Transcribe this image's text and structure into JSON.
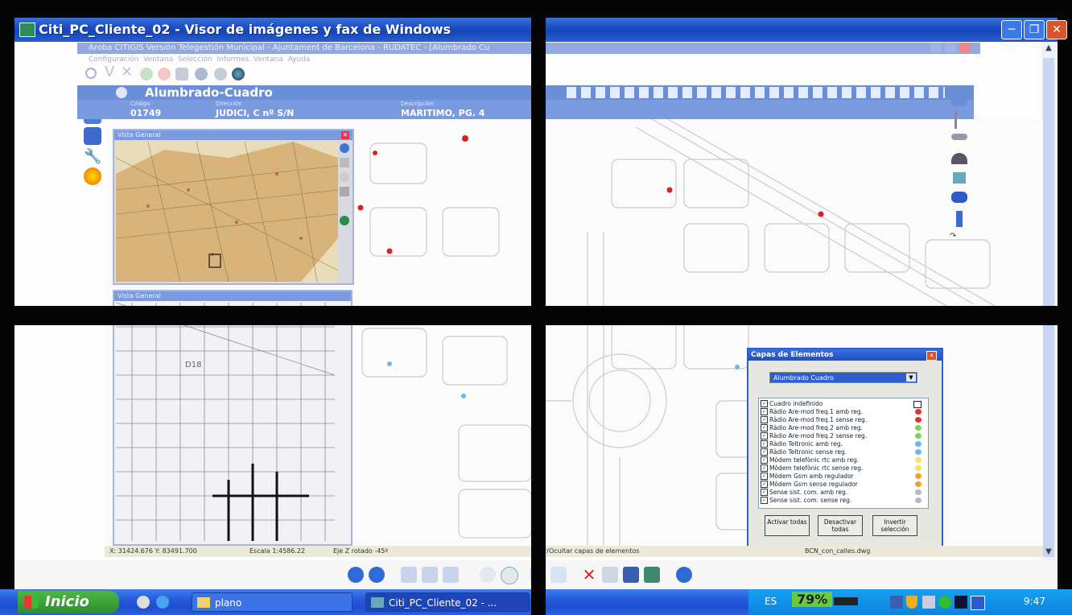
{
  "window": {
    "title": "Citi_PC_Cliente_02 - Visor de imágenes y fax de Windows",
    "controls": [
      "minimize",
      "maximize",
      "close"
    ]
  },
  "app": {
    "title": "Aroba CITIGIS Versión Telegestión Municipal - Ajuntament de Barcelona - RUDATEC - [Alumbrado Cu",
    "menu": [
      "Configuración",
      "Ventana",
      "Selección",
      "Informes",
      "Ventana",
      "Ayuda"
    ],
    "record_header": "Alumbrado-Cuadro",
    "fields": [
      {
        "label": "Código",
        "value": "01749"
      },
      {
        "label": "Dirección",
        "value": "JUDICI, C nº S/N"
      },
      {
        "label": "Descripción",
        "value": "MARITIMO, PG. 4"
      }
    ]
  },
  "overview": {
    "title_1": "Vista General",
    "title_2": "Vista General",
    "map_label": "D18"
  },
  "layers_panel": {
    "title": "Capas de Elementos",
    "selected": "Alumbrado Cuadro",
    "items": [
      {
        "label": "Cuadro indefinido",
        "color": "#ffffff"
      },
      {
        "label": "Ràdio Are-mod freq.1 amb reg.",
        "color": "#e8302a"
      },
      {
        "label": "Ràdio Are-mod freq.1 sense reg.",
        "color": "#e8302a"
      },
      {
        "label": "Ràdio Are-mod freq.2 amb reg.",
        "color": "#7bd35a"
      },
      {
        "label": "Ràdio Are-mod freq.2 sense reg.",
        "color": "#7bd35a"
      },
      {
        "label": "Ràdio Teltronic amb reg.",
        "color": "#6fb6ea"
      },
      {
        "label": "Ràdio Teltronic sense reg.",
        "color": "#6fb6ea"
      },
      {
        "label": "Mòdem telefònic rtc amb reg.",
        "color": "#f2e46a"
      },
      {
        "label": "Mòdem telefònic rtc sense reg.",
        "color": "#f2e46a"
      },
      {
        "label": "Mòdem Gsm amb regulador",
        "color": "#f0a030"
      },
      {
        "label": "Mòdem Gsm sense regulador",
        "color": "#f0a030"
      },
      {
        "label": "Sense sist. com. amb reg.",
        "color": "#b8b8c0"
      },
      {
        "label": "Sense sist. com. sense reg.",
        "color": "#b8b8c0"
      }
    ],
    "buttons": [
      "Activar todas",
      "Desactivar todas",
      "Invertir selección"
    ]
  },
  "status_bar": {
    "coords": "X: 31424.676  Y: 83491.700",
    "scale": "Escala 1:4586.22",
    "rotation": "Eje Z rotado -45º",
    "layers_hint": "r/Ocultar capas de elementos",
    "file": "BCN_con_calles.dwg"
  },
  "taskbar": {
    "start_label": "Inicio",
    "tasks": [
      {
        "label": "plano"
      },
      {
        "label": "Citi_PC_Cliente_02 - ..."
      }
    ],
    "language": "ES",
    "percent": "79%",
    "time": "9:47"
  },
  "colors": {
    "xp_blue": "#1c4ec2",
    "app_header": "#6a8ed8",
    "map_point_red": "#e02020",
    "map_point_blue": "#6fb6ea",
    "taskbar_green": "#2d8f2d"
  }
}
